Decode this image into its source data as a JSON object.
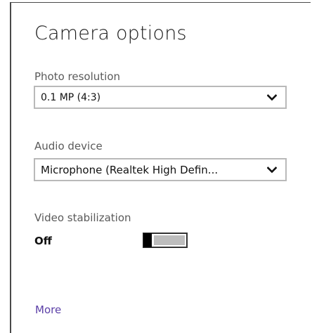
{
  "panel": {
    "title": "Camera options"
  },
  "photo_resolution": {
    "label": "Photo resolution",
    "value": "0.1 MP (4:3)"
  },
  "audio_device": {
    "label": "Audio device",
    "value": "Microphone (Realtek High Defin..."
  },
  "video_stabilization": {
    "label": "Video stabilization",
    "state": "Off",
    "on": false
  },
  "more": {
    "label": "More"
  },
  "colors": {
    "link": "#5b3fa7",
    "border": "#b9b9b9",
    "toggle_off_track": "#bdbdbd"
  },
  "icons": {
    "dropdown": "chevron-down-icon"
  }
}
